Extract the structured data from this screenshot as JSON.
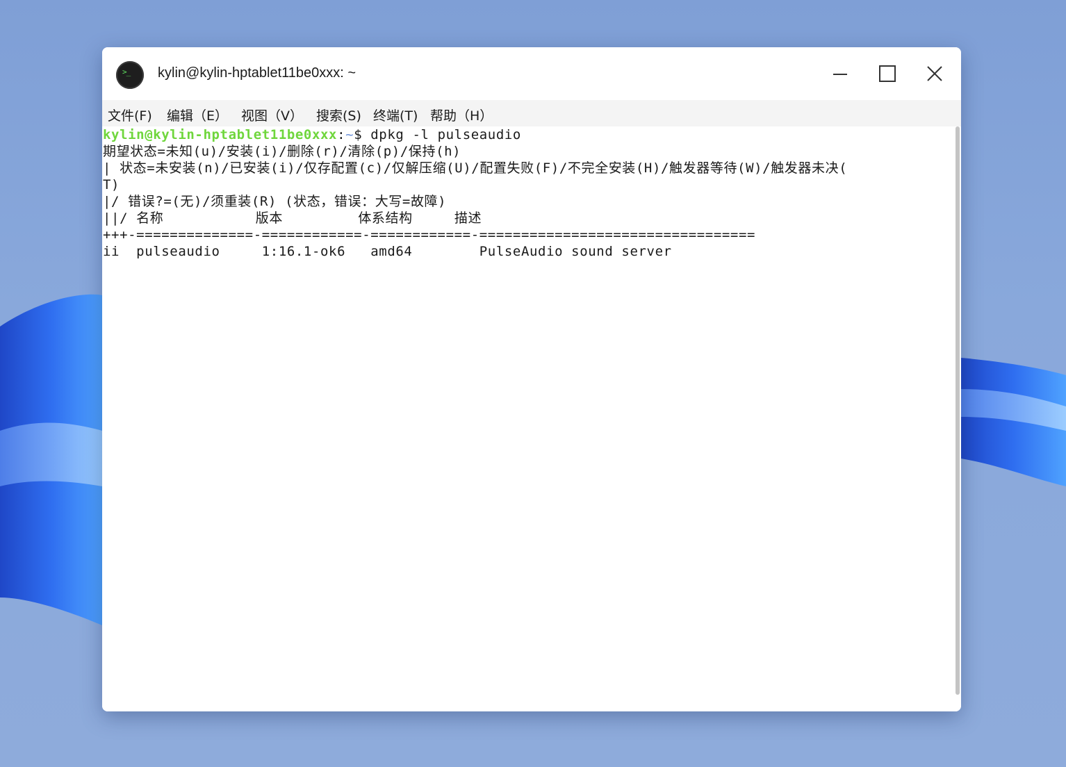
{
  "window": {
    "title": "kylin@kylin-hptablet11be0xxx: ~",
    "app_icon": "terminal-icon",
    "controls": [
      "minimize-icon",
      "maximize-icon",
      "close-icon"
    ]
  },
  "menu": {
    "items": [
      {
        "label": "文件(F)"
      },
      {
        "label": "编辑（E）"
      },
      {
        "label": "视图（V）"
      },
      {
        "label": "搜索(S)"
      },
      {
        "label": "终端(T)"
      },
      {
        "label": "帮助（H）"
      }
    ]
  },
  "terminal": {
    "prompt_user": "kylin@kylin-hptablet11be0xxx",
    "prompt_sep": ":",
    "prompt_path": "~",
    "prompt_symbol": "$ ",
    "command": "dpkg -l pulseaudio",
    "lines": [
      "期望状态=未知(u)/安装(i)/删除(r)/清除(p)/保持(h)",
      "| 状态=未安装(n)/已安装(i)/仅存配置(c)/仅解压缩(U)/配置失败(F)/不完全安装(H)/触发器等待(W)/触发器未决(",
      "T)",
      "|/ 错误?=(无)/须重装(R) (状态，错误：大写=故障)",
      "||/ 名称           版本         体系结构     描述",
      "+++-==============-============-============-=================================",
      "ii  pulseaudio     1:16.1-ok6   amd64        PulseAudio sound server"
    ]
  }
}
